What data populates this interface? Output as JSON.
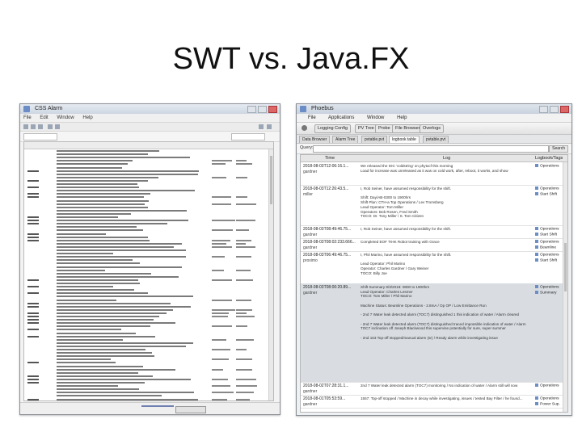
{
  "slide": {
    "title": "SWT vs. Java.FX"
  },
  "swt": {
    "window_title": "CSS Alarm",
    "menu": [
      "File",
      "Edit",
      "Window",
      "Help"
    ]
  },
  "fx": {
    "window_title": "Phoebus",
    "menu": [
      "File",
      "Applications",
      "Window",
      "Help"
    ],
    "toolbar": [
      "Logging Config",
      "PV Tree",
      "Probe",
      "File Browser",
      "Overlogs"
    ],
    "tabs": [
      "Data Browser",
      "Alarm Tree",
      "pvtable.pvt",
      "logbook table",
      "pvtable.pvt"
    ],
    "query_label": "Query:",
    "search_button": "Search",
    "columns": {
      "time": "Time",
      "log": "Log",
      "tags": "Logbook/Tags"
    },
    "entries": [
      {
        "date": "2018-08-03T12:06:16.1...",
        "author": "gardner",
        "lines": [
          "We released the IOC 'coldstring' on phytocf this morning",
          "Load for increase was unreleased as it was on cold work, after, reboot, it works, and show"
        ],
        "tags": [
          "Operations"
        ]
      },
      {
        "date": "2018-08-03T12:26:43.5...",
        "author": "miller",
        "lines": [
          "I, Rob Seiner, have assumed responsibility for the shift.",
          "",
          "Shift: Day/AB-0300 to 1900hrs",
          "Shift Plan: CTH-a Top Operations / Lev Tromsberg",
          "Lead Operator: Tom Miller",
          "Operators: Bob Rosen, Fred Smith",
          "TOCO: Dr. Tony Miller / S. Tom Citizen"
        ],
        "tags": [
          "Operations",
          "Start Shift"
        ]
      },
      {
        "date": "2018-08-03T08:49:46.75...",
        "author": "gardner",
        "lines": [
          "I, Rob Seiner, have assumed responsibility for the shift."
        ],
        "tags": [
          "Operations",
          "Start Shift"
        ]
      },
      {
        "date": "2018-08-03T08:02:233.666...",
        "author": "gardner",
        "lines": [
          "Completed EOF TIHK Robot training with Grace"
        ],
        "tags": [
          "Operations",
          "Beamline"
        ]
      },
      {
        "date": "2018-08-03T06:49:46.75...",
        "author": "proximo",
        "lines": [
          "I, Phil Marino, have assumed responsibility for the shift.",
          "",
          "Lead Operator: Phil Marino",
          "Operator: Charles Gardner / Gary Weiner",
          "TOCO: Billy Joe"
        ],
        "tags": [
          "Operations",
          "Start Shift"
        ]
      },
      {
        "date": "2018-08-03T08:00:20.89...",
        "author": "gardner",
        "lines": [
          "Shift Summary 8/3/2018: 0800 to 1900hrs",
          "Lead Operator: Charles Lesmer",
          "TOCO: Tom Miller / Phil Marino",
          "",
          "Machine Status: Beamline Operations - 2.8mA / Op OP / Low Emittance Run",
          "",
          "- 2nd 7 Water leak detected alarm (TOC7) distinguished 1 this indication of water / Alarm cleared",
          "",
          "- 2nd 7 Water leak detected alarm (TOC7) distinguished traced impossible indication of water / Alarm",
          "TOC7 inclination off Joseph Blackwood this supervise potentially for sure, super summer",
          "",
          "- 2nd 163 Top-off stopped/manual alarm (sr) / Ready alarm while investigating issue"
        ],
        "tags": [
          "Operations",
          "Summary"
        ]
      },
      {
        "date": "2018-08-02T07:28:31.1...",
        "author": "gardner",
        "lines": [
          "2nd 7 Water leak detected alarm (TOC7) monitoring / No indication of water / Alarm still will now"
        ],
        "tags": [
          "Operations"
        ]
      },
      {
        "date": "2018-08-01T05:53:59...",
        "author": "gardner",
        "lines": [
          "1557: Top-off stopped / Machine in decay while investigating, issues / tested Bay Filter / he found..."
        ],
        "tags": [
          "Operations",
          "Power Sup."
        ]
      }
    ]
  }
}
